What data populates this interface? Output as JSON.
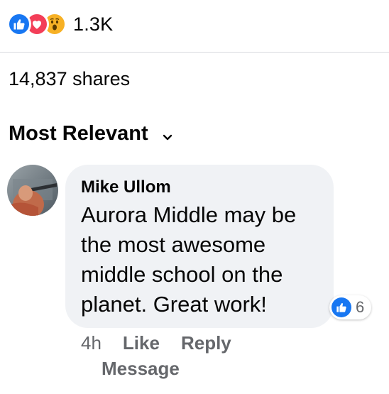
{
  "reactions": {
    "icons": [
      "like-icon",
      "love-icon",
      "wow-icon"
    ],
    "count": "1.3K"
  },
  "shares": "14,837 shares",
  "sort": {
    "label": "Most Relevant",
    "icon": "chevron-down-icon"
  },
  "comment": {
    "author": "Mike Ullom",
    "text": "Aurora Middle may be the most awesome middle school on the planet. Great work!",
    "likes": "6",
    "time": "4h",
    "like_label": "Like",
    "reply_label": "Reply",
    "message_label": "Message"
  },
  "colors": {
    "like_blue": "#1877f2",
    "love_red": "#f33e58",
    "wow_yellow": "#f7b125",
    "bubble_gray": "#f0f2f5",
    "secondary_text": "#65676b"
  }
}
